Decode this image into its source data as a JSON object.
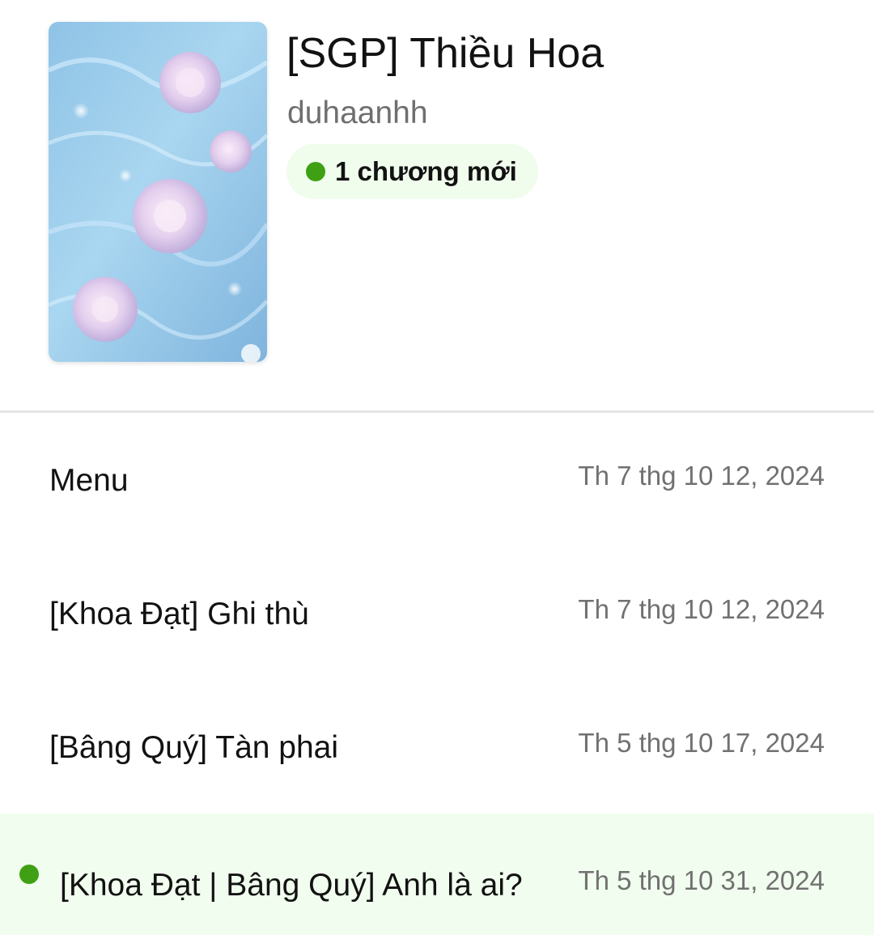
{
  "story": {
    "title": "[SGP] Thiều Hoa",
    "author": "duhaanhh",
    "new_badge": {
      "label": "1 chương mới",
      "dot_color": "#3fa014"
    },
    "cover_icon": "cover-image"
  },
  "chapters": [
    {
      "title": "Menu",
      "date": "Th 7 thg 10 12, 2024",
      "is_new": false
    },
    {
      "title": "[Khoa Đạt] Ghi thù",
      "date": "Th 7 thg 10 12, 2024",
      "is_new": false
    },
    {
      "title": "[Bâng Quý] Tàn phai",
      "date": "Th 5 thg 10 17, 2024",
      "is_new": false
    },
    {
      "title": "[Khoa Đạt | Bâng Quý] Anh là ai?",
      "date": "Th 5 thg 10 31, 2024",
      "is_new": true
    }
  ],
  "colors": {
    "accent_green": "#3fa014",
    "new_row_background": "#f1fdee",
    "badge_background": "#f0fcec"
  }
}
